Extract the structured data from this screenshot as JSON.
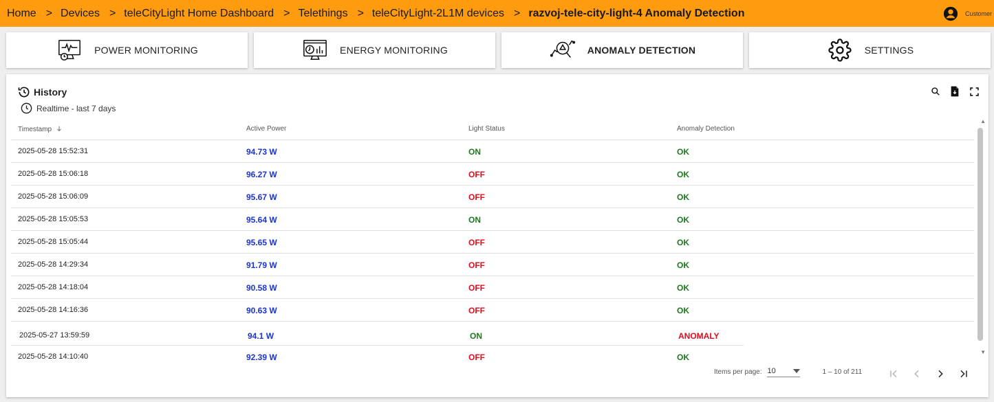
{
  "breadcrumb": [
    {
      "label": "Home"
    },
    {
      "label": "Devices"
    },
    {
      "label": "teleCityLight Home Dashboard"
    },
    {
      "label": "Telethings"
    },
    {
      "label": "teleCityLight-2L1M devices"
    },
    {
      "label": "razvoj-tele-city-light-4 Anomaly Detection"
    }
  ],
  "breadcrumb_separator": ">",
  "user": {
    "label": "Customer"
  },
  "tiles": [
    {
      "label": "POWER MONITORING",
      "icon": "power-monitor-icon"
    },
    {
      "label": "ENERGY MONITORING",
      "icon": "energy-monitor-icon"
    },
    {
      "label": "ANOMALY DETECTION",
      "icon": "anomaly-search-icon"
    },
    {
      "label": "SETTINGS",
      "icon": "gear-icon"
    }
  ],
  "card": {
    "title": "History",
    "subtitle": "Realtime - last 7 days",
    "columns": [
      "Timestamp",
      "Active Power",
      "Light Status",
      "Anomaly Detection"
    ],
    "sort_icon": "arrow-down-icon",
    "rows": [
      {
        "ts": "2025-05-28 15:52:31",
        "power": "94.73 W",
        "status": "ON",
        "anomaly": "OK"
      },
      {
        "ts": "2025-05-28 15:06:18",
        "power": "96.27 W",
        "status": "OFF",
        "anomaly": "OK"
      },
      {
        "ts": "2025-05-28 15:06:09",
        "power": "95.67 W",
        "status": "OFF",
        "anomaly": "OK"
      },
      {
        "ts": "2025-05-28 15:05:53",
        "power": "95.64 W",
        "status": "ON",
        "anomaly": "OK"
      },
      {
        "ts": "2025-05-28 15:05:44",
        "power": "95.65 W",
        "status": "OFF",
        "anomaly": "OK"
      },
      {
        "ts": "2025-05-28 14:29:34",
        "power": "91.79 W",
        "status": "OFF",
        "anomaly": "OK"
      },
      {
        "ts": "2025-05-28 14:18:04",
        "power": "90.58 W",
        "status": "OFF",
        "anomaly": "OK"
      },
      {
        "ts": "2025-05-28 14:16:36",
        "power": "90.63 W",
        "status": "OFF",
        "anomaly": "OK"
      },
      {
        "ts": "2025-05-27 13:59:59",
        "power": "94.1 W",
        "status": "ON",
        "anomaly": "ANOMALY"
      },
      {
        "ts": "2025-05-28 14:10:40",
        "power": "92.39 W",
        "status": "OFF",
        "anomaly": "OK"
      }
    ]
  },
  "pagination": {
    "items_per_page_label": "Items per page:",
    "items_per_page_value": "10",
    "range": "1 – 10 of 211"
  },
  "colors": {
    "topbar": "#ff9b0f",
    "power": "#1a33d6",
    "on_ok": "#1b7a1b",
    "off_anomaly": "#e00d1d"
  }
}
